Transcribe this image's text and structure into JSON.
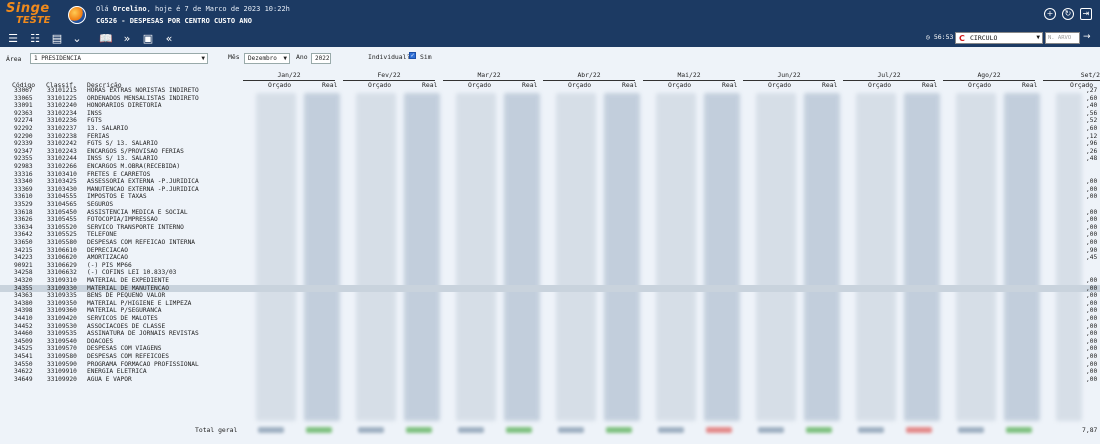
{
  "header": {
    "logo_line1": "Singe",
    "logo_line2": "TESTE",
    "greeting_prefix": "Olá ",
    "user": "Orcelino",
    "greeting_suffix": ", hoje é 7 de Marco de 2023 10:22h",
    "title": "CG526 - DESPESAS POR CENTRO CUSTO ANO"
  },
  "toolbar": {
    "timer": "56:53",
    "company": "CIRCULO",
    "search_placeholder": "N. ARVO"
  },
  "filters": {
    "area_label": "Área",
    "area_value": "1        PRESIDENCIA",
    "mes_label": "Mês",
    "mes_value": "Dezembro",
    "ano_label": "Ano",
    "ano_value": "2022",
    "individual_label": "Individual?",
    "sim_label": "Sim"
  },
  "table": {
    "col_codigo": "Código",
    "col_classif": "Classif.",
    "col_descricao": "Descrição",
    "sub_orcado": "Orçado",
    "sub_real": "Real",
    "months": [
      "Jan/22",
      "Fev/22",
      "Mar/22",
      "Abr/22",
      "Mai/22",
      "Jun/22",
      "Jul/22",
      "Ago/22",
      "Set/2"
    ],
    "total_label": "Total geral",
    "total_tail": "7,87",
    "rows": [
      {
        "code": "33067",
        "cls": "33101215",
        "desc": "HORAS EXTRAS NORISTAS INDIRETO",
        "tail": ",27"
      },
      {
        "code": "33065",
        "cls": "33101225",
        "desc": "ORDENADOS MENSALISTAS INDIRETO",
        "tail": ",60"
      },
      {
        "code": "33091",
        "cls": "33102240",
        "desc": "HONORARIOS DIRETORIA",
        "tail": ",40"
      },
      {
        "code": "92363",
        "cls": "33102234",
        "desc": "INSS",
        "tail": ",56"
      },
      {
        "code": "92274",
        "cls": "33102236",
        "desc": "FGTS",
        "tail": ",52"
      },
      {
        "code": "92292",
        "cls": "33102237",
        "desc": "13. SALARIO",
        "tail": ",60"
      },
      {
        "code": "92290",
        "cls": "33102238",
        "desc": "FERIAS",
        "tail": ",12"
      },
      {
        "code": "92339",
        "cls": "33102242",
        "desc": "FGTS S/ 13. SALARIO",
        "tail": ",96"
      },
      {
        "code": "92347",
        "cls": "33102243",
        "desc": "ENCARGOS S/PROVISAO FERIAS",
        "tail": ",26"
      },
      {
        "code": "92355",
        "cls": "33102244",
        "desc": "INSS S/ 13. SALARIO",
        "tail": ",48"
      },
      {
        "code": "92983",
        "cls": "33102266",
        "desc": "ENCARGOS M.OBRA(RECEBIDA)",
        "tail": ""
      },
      {
        "code": "33316",
        "cls": "33103410",
        "desc": "FRETES E CARRETOS",
        "tail": ""
      },
      {
        "code": "33340",
        "cls": "33103425",
        "desc": "ASSESSORIA EXTERNA -P.JURIDICA",
        "tail": ",00"
      },
      {
        "code": "33369",
        "cls": "33103430",
        "desc": "MANUTENCAO EXTERNA -P.JURIDICA",
        "tail": ",00"
      },
      {
        "code": "33610",
        "cls": "33104555",
        "desc": "IMPOSTOS E TAXAS",
        "tail": ",00"
      },
      {
        "code": "33529",
        "cls": "33104565",
        "desc": "SEGUROS",
        "tail": ""
      },
      {
        "code": "33618",
        "cls": "33105450",
        "desc": "ASSISTENCIA MEDICA E SOCIAL",
        "tail": ",00"
      },
      {
        "code": "33626",
        "cls": "33105455",
        "desc": "FOTOCOPIA/IMPRESSAO",
        "tail": ",00"
      },
      {
        "code": "33634",
        "cls": "33105520",
        "desc": "SERVICO TRANSPORTE INTERNO",
        "tail": ",00"
      },
      {
        "code": "33642",
        "cls": "33105525",
        "desc": "TELEFONE",
        "tail": ",00"
      },
      {
        "code": "33650",
        "cls": "33105580",
        "desc": "DESPESAS COM REFEICAO INTERNA",
        "tail": ",00"
      },
      {
        "code": "34215",
        "cls": "33106610",
        "desc": "DEPRECIACAO",
        "tail": ",90"
      },
      {
        "code": "34223",
        "cls": "33106620",
        "desc": "AMORTIZACAO",
        "tail": ",45"
      },
      {
        "code": "90921",
        "cls": "33106629",
        "desc": "(-) PIS MP66",
        "tail": ""
      },
      {
        "code": "34258",
        "cls": "33106632",
        "desc": "(-) COFINS LEI 10.833/03",
        "tail": ""
      },
      {
        "code": "34320",
        "cls": "33109310",
        "desc": "MATERIAL DE EXPEDIENTE",
        "tail": ",00"
      },
      {
        "code": "34355",
        "cls": "33109330",
        "desc": "MATERIAL DE MANUTENCAO",
        "tail": ",00"
      },
      {
        "code": "34363",
        "cls": "33109335",
        "desc": "BENS DE PEQUENO VALOR",
        "tail": ",00"
      },
      {
        "code": "34380",
        "cls": "33109350",
        "desc": "MATERIAL P/HIGIENE E LIMPEZA",
        "tail": ",00"
      },
      {
        "code": "34398",
        "cls": "33109360",
        "desc": "MATERIAL P/SEGURANCA",
        "tail": ",00"
      },
      {
        "code": "34410",
        "cls": "33109420",
        "desc": "SERVICOS DE MALOTES",
        "tail": ",00"
      },
      {
        "code": "34452",
        "cls": "33109530",
        "desc": "ASSOCIACOES DE CLASSE",
        "tail": ",00"
      },
      {
        "code": "34460",
        "cls": "33109535",
        "desc": "ASSINATURA DE JORNAIS REVISTAS",
        "tail": ",00"
      },
      {
        "code": "34509",
        "cls": "33109540",
        "desc": "DOACOES",
        "tail": ",00"
      },
      {
        "code": "34525",
        "cls": "33109570",
        "desc": "DESPESAS COM VIAGENS",
        "tail": ",00"
      },
      {
        "code": "34541",
        "cls": "33109580",
        "desc": "DESPESAS COM REFEICOES",
        "tail": ",00"
      },
      {
        "code": "34550",
        "cls": "33109590",
        "desc": "PROGRAMA FORMACAO PROFISSIONAL",
        "tail": ",00"
      },
      {
        "code": "34622",
        "cls": "33109910",
        "desc": "ENERGIA ELETRICA",
        "tail": ",00"
      },
      {
        "code": "34649",
        "cls": "33109920",
        "desc": "AGUA E VAPOR",
        "tail": ",00"
      }
    ]
  }
}
